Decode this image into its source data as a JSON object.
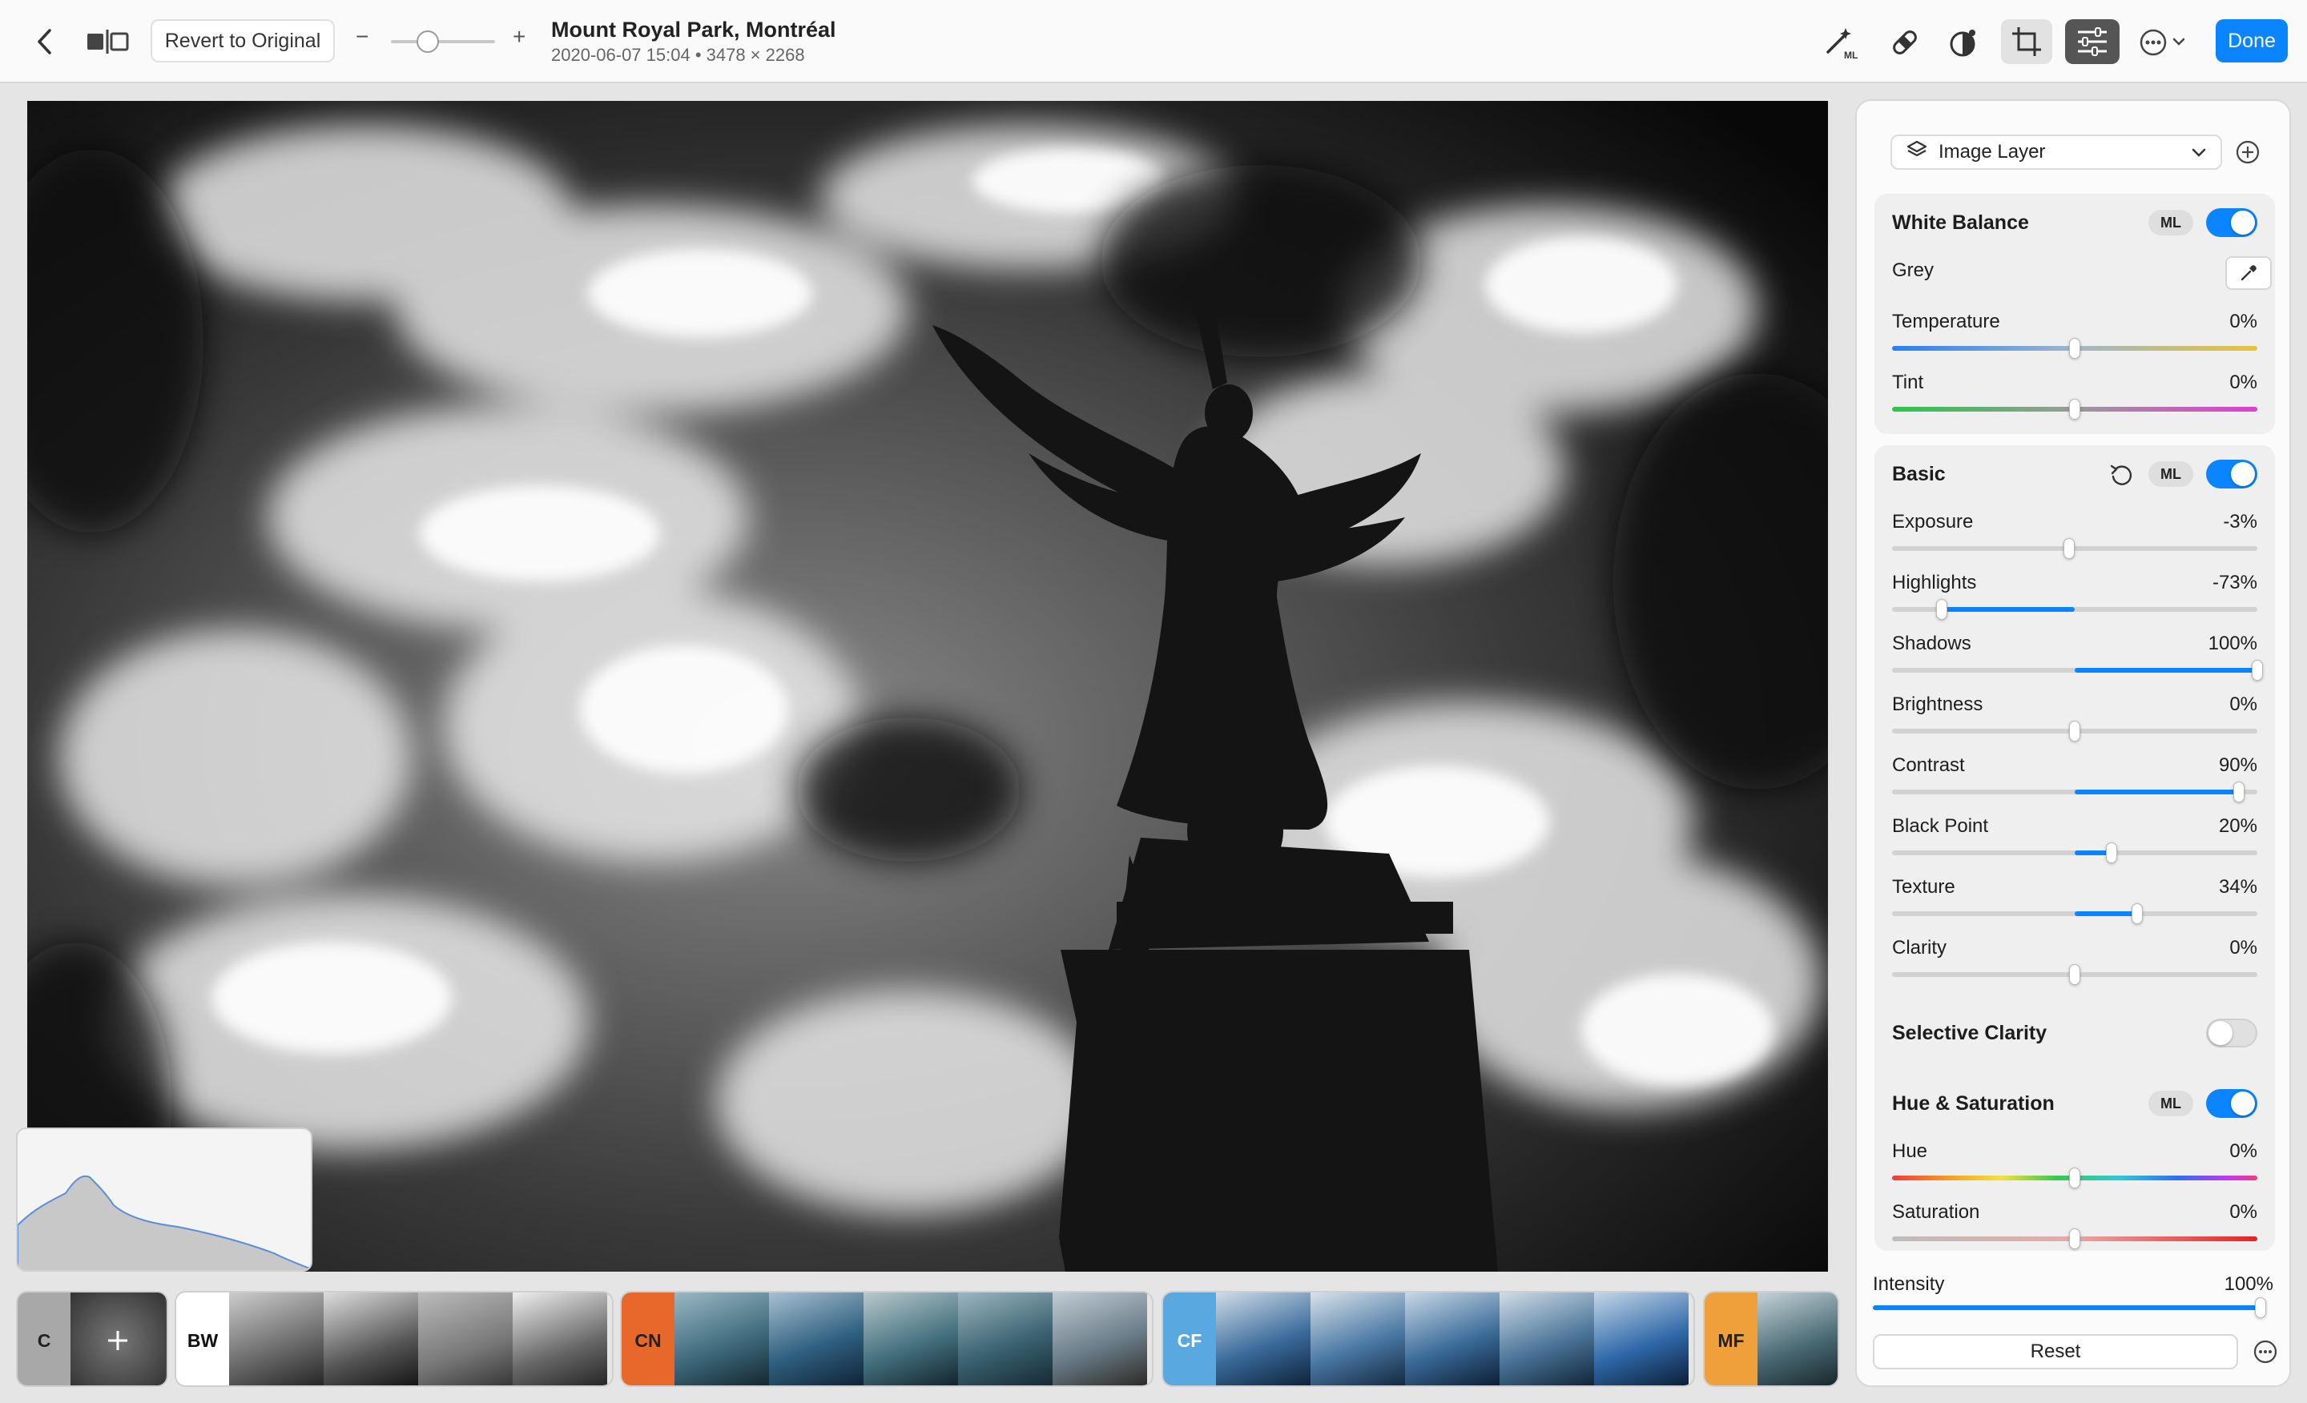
{
  "toolbar": {
    "revert_label": "Revert to Original",
    "zoom_minus": "−",
    "zoom_plus": "+",
    "title": "Mount Royal Park, Montréal",
    "subtitle": "2020-06-07 15:04 • 3478 × 2268",
    "done_label": "Done",
    "icons": [
      "back-icon",
      "compare-icon",
      "ml-magic-wand-icon",
      "retouch-bandage-icon",
      "effects-icon",
      "crop-icon",
      "adjustments-icon",
      "more-icon"
    ]
  },
  "presets": [
    {
      "label": "C",
      "color": "#a8a8a8",
      "text_color": "#222222"
    },
    {
      "label": "BW",
      "color": "#ffffff",
      "text_color": "#111111"
    },
    {
      "label": "CN",
      "color": "#e8672a",
      "text_color": "#222222"
    },
    {
      "label": "CF",
      "color": "#5aa8e0",
      "text_color": "#ffffff"
    },
    {
      "label": "MF",
      "color": "#f0a03a",
      "text_color": "#222222"
    }
  ],
  "panel": {
    "layer_label": "Image Layer",
    "white_balance": {
      "title": "White Balance",
      "ml": "ML",
      "enabled": true,
      "grey_label": "Grey",
      "sliders": [
        {
          "label": "Temperature",
          "value": "0%",
          "pct": 0
        },
        {
          "label": "Tint",
          "value": "0%",
          "pct": 0
        }
      ]
    },
    "basic": {
      "title": "Basic",
      "ml": "ML",
      "enabled": true,
      "sliders": [
        {
          "label": "Exposure",
          "value": "-3%",
          "pct": -3
        },
        {
          "label": "Highlights",
          "value": "-73%",
          "pct": -73
        },
        {
          "label": "Shadows",
          "value": "100%",
          "pct": 100
        },
        {
          "label": "Brightness",
          "value": "0%",
          "pct": 0
        },
        {
          "label": "Contrast",
          "value": "90%",
          "pct": 90
        },
        {
          "label": "Black Point",
          "value": "20%",
          "pct": 20
        },
        {
          "label": "Texture",
          "value": "34%",
          "pct": 34
        },
        {
          "label": "Clarity",
          "value": "0%",
          "pct": 0
        }
      ]
    },
    "selective_clarity": {
      "title": "Selective Clarity",
      "enabled": false
    },
    "hue_saturation": {
      "title": "Hue & Saturation",
      "ml": "ML",
      "enabled": true,
      "sliders": [
        {
          "label": "Hue",
          "value": "0%",
          "pct": 0
        },
        {
          "label": "Saturation",
          "value": "0%",
          "pct": 0
        }
      ]
    },
    "intensity": {
      "label": "Intensity",
      "value": "100%",
      "pct": 100
    },
    "reset_label": "Reset"
  }
}
